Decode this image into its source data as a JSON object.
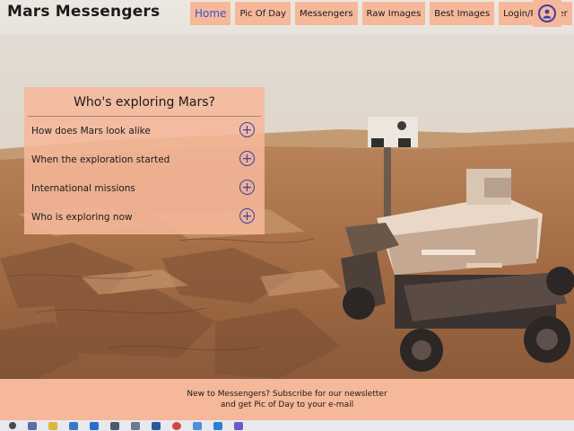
{
  "header": {
    "brand": "Mars Messengers",
    "nav": [
      {
        "label": "Home",
        "active": true
      },
      {
        "label": "Pic Of Day",
        "active": false
      },
      {
        "label": "Messengers",
        "active": false
      },
      {
        "label": "Raw Images",
        "active": false
      },
      {
        "label": "Best Images",
        "active": false
      },
      {
        "label": "Login/Register",
        "active": false
      }
    ],
    "account_icon": "user-icon"
  },
  "accordion": {
    "title": "Who's exploring Mars?",
    "items": [
      {
        "label": "How does Mars look alike"
      },
      {
        "label": "When the exploration started"
      },
      {
        "label": "International missions"
      },
      {
        "label": "Who is exploring now"
      }
    ],
    "expand_icon": "plus-circle-icon"
  },
  "footer": {
    "line1": "New to Messengers? Subscribe for our newsletter",
    "line2": "and get Pic of Day to your e-mail"
  },
  "colors": {
    "accent": "#f6b89a",
    "link_active": "#3d52d5",
    "icon": "#3c3fa6"
  }
}
